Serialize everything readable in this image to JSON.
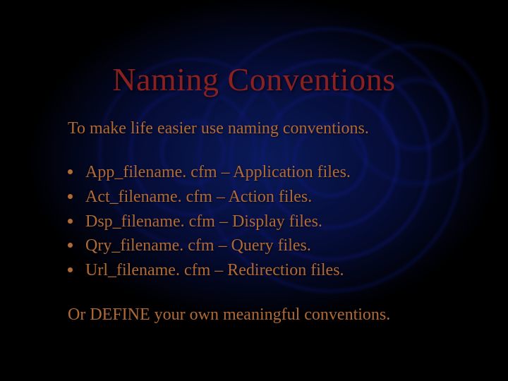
{
  "title": "Naming Conventions",
  "intro": "To make life easier use naming conventions.",
  "bullets": [
    "App_filename. cfm – Application files.",
    "Act_filename. cfm – Action files.",
    "Dsp_filename. cfm – Display files.",
    "Qry_filename. cfm – Query files.",
    "Url_filename. cfm – Redirection files."
  ],
  "outro": "Or DEFINE your own meaningful conventions."
}
